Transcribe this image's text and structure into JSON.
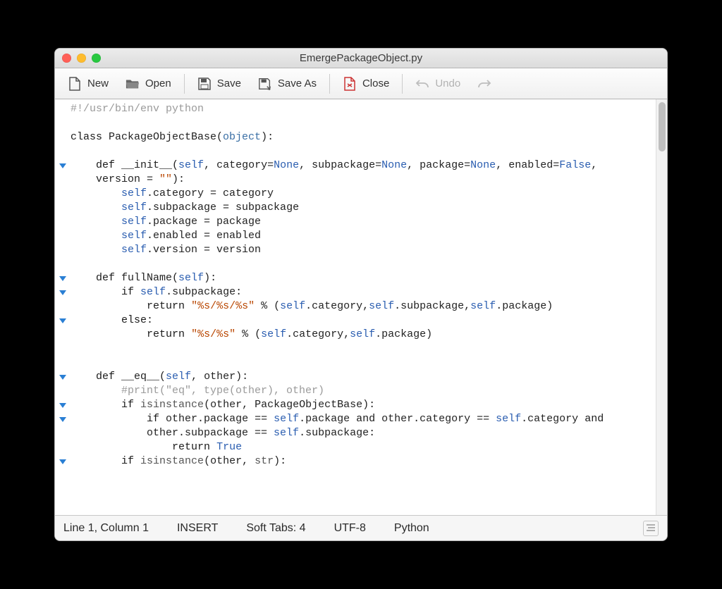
{
  "window": {
    "title": "EmergePackageObject.py"
  },
  "toolbar": {
    "new_label": "New",
    "open_label": "Open",
    "save_label": "Save",
    "save_as_label": "Save As",
    "close_label": "Close",
    "undo_label": "Undo"
  },
  "code": {
    "lines": [
      {
        "fold": false,
        "html": "<span class='c-comment'>#!/usr/bin/env python</span>"
      },
      {
        "fold": false,
        "html": ""
      },
      {
        "fold": false,
        "html": "<span class='c-kw'>class</span> PackageObjectBase(<span class='c-def'>object</span>):"
      },
      {
        "fold": false,
        "html": ""
      },
      {
        "fold": true,
        "html": "    <span class='c-kw'>def</span> __init__(<span class='c-self'>self</span>, category=<span class='c-const'>None</span>, subpackage=<span class='c-const'>None</span>, package=<span class='c-const'>None</span>, enabled=<span class='c-const'>False</span>, "
      },
      {
        "fold": false,
        "html": "    version = <span class='c-str'>\"\"</span>):"
      },
      {
        "fold": false,
        "html": "        <span class='c-self'>self</span>.category = category"
      },
      {
        "fold": false,
        "html": "        <span class='c-self'>self</span>.subpackage = subpackage"
      },
      {
        "fold": false,
        "html": "        <span class='c-self'>self</span>.package = package"
      },
      {
        "fold": false,
        "html": "        <span class='c-self'>self</span>.enabled = enabled"
      },
      {
        "fold": false,
        "html": "        <span class='c-self'>self</span>.version = version"
      },
      {
        "fold": false,
        "html": ""
      },
      {
        "fold": true,
        "html": "    <span class='c-kw'>def</span> fullName(<span class='c-self'>self</span>):"
      },
      {
        "fold": true,
        "html": "        <span class='c-kw'>if</span> <span class='c-self'>self</span>.subpackage:"
      },
      {
        "fold": false,
        "html": "            <span class='c-kw'>return</span> <span class='c-str'>\"%s/%s/%s\"</span> % (<span class='c-self'>self</span>.category,<span class='c-self'>self</span>.subpackage,<span class='c-self'>self</span>.package)"
      },
      {
        "fold": true,
        "html": "        <span class='c-kw'>else</span>:"
      },
      {
        "fold": false,
        "html": "            <span class='c-kw'>return</span> <span class='c-str'>\"%s/%s\"</span> % (<span class='c-self'>self</span>.category,<span class='c-self'>self</span>.package)"
      },
      {
        "fold": false,
        "html": ""
      },
      {
        "fold": false,
        "html": ""
      },
      {
        "fold": true,
        "html": "    <span class='c-kw'>def</span> __eq__(<span class='c-self'>self</span>, other):"
      },
      {
        "fold": false,
        "html": "        <span class='c-comment'>#print(\"eq\", type(other), other)</span>"
      },
      {
        "fold": true,
        "html": "        <span class='c-kw'>if</span> <span class='c-builtin'>isinstance</span>(other, PackageObjectBase):"
      },
      {
        "fold": true,
        "html": "            <span class='c-kw'>if</span> other.package == <span class='c-self'>self</span>.package <span class='c-kw'>and</span> other.category == <span class='c-self'>self</span>.category <span class='c-kw'>and</span>"
      },
      {
        "fold": false,
        "html": "            other.subpackage == <span class='c-self'>self</span>.subpackage:"
      },
      {
        "fold": false,
        "html": "                <span class='c-kw'>return</span> <span class='c-const'>True</span>"
      },
      {
        "fold": true,
        "html": "        <span class='c-kw'>if</span> <span class='c-builtin'>isinstance</span>(other, <span class='c-builtin'>str</span>):"
      }
    ]
  },
  "status": {
    "position": "Line 1, Column 1",
    "mode": "INSERT",
    "tabs": "Soft Tabs: 4",
    "encoding": "UTF-8",
    "language": "Python"
  }
}
